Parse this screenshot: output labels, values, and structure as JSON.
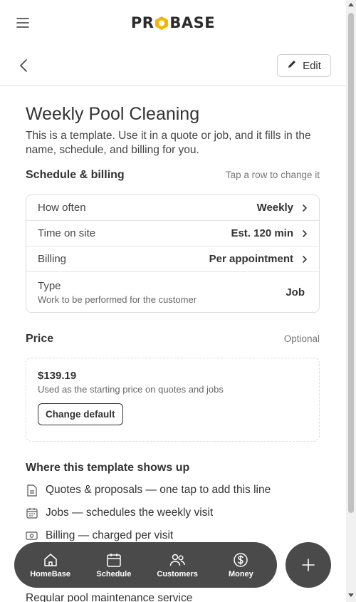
{
  "brand": {
    "logo_left": "PR",
    "logo_right": "BASE"
  },
  "header": {
    "edit_label": "Edit"
  },
  "template": {
    "title": "Weekly Pool Cleaning",
    "description": "This is a template. Use it in a quote or job, and it fills in the name, schedule, and billing for you."
  },
  "schedule": {
    "title": "Schedule & billing",
    "hint": "Tap a row to change it",
    "rows": [
      {
        "label": "How often",
        "value": "Weekly"
      },
      {
        "label": "Time on site",
        "value": "Est. 120 min"
      },
      {
        "label": "Billing",
        "value": "Per appointment"
      },
      {
        "label": "Type",
        "sub": "Work to be performed for the customer",
        "value": "Job"
      }
    ]
  },
  "price": {
    "title": "Price",
    "hint": "Optional",
    "amount": "$139.19",
    "note": "Used as the starting price on quotes and jobs",
    "change_label": "Change default"
  },
  "shows_up": {
    "title": "Where this template shows up",
    "items": [
      {
        "icon": "document-icon",
        "text": "Quotes & proposals — one tap to add this line"
      },
      {
        "icon": "calendar-icon",
        "text": "Jobs — schedules the weekly visit"
      },
      {
        "icon": "cash-icon",
        "text": "Billing — charged per visit"
      }
    ]
  },
  "partial_text": "Regular pool maintenance service",
  "nav": {
    "items": [
      {
        "icon": "home-icon",
        "label": "HomeBase"
      },
      {
        "icon": "calendar-icon",
        "label": "Schedule"
      },
      {
        "icon": "users-icon",
        "label": "Customers"
      },
      {
        "icon": "dollar-icon",
        "label": "Money"
      }
    ],
    "fab_icon": "plus-icon"
  },
  "colors": {
    "nav_bg": "#4a4a4a",
    "logo_accent": "#f2b705",
    "text": "#333333"
  }
}
